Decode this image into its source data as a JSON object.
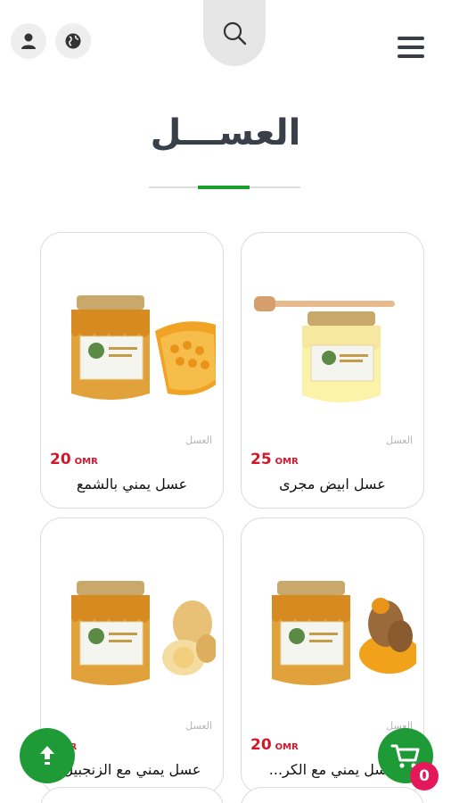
{
  "header": {
    "user_icon": "user-icon",
    "globe_icon": "globe-icon",
    "search_icon": "search-icon",
    "menu_icon": "hamburger-menu-icon"
  },
  "page_title": "العســـل",
  "colors": {
    "accent_green": "#1c9e2d",
    "price_red": "#d0182a",
    "badge_pink": "#e5195a"
  },
  "products": [
    {
      "name": "عسل ابيض مجرى",
      "category": "العسل",
      "price": "25",
      "currency": "OMR"
    },
    {
      "name": "عسل يمني بالشمع",
      "category": "العسل",
      "price": "20",
      "currency": "OMR"
    },
    {
      "name": "عسل يمني مع الكر...",
      "category": "العسل",
      "price": "20",
      "currency": "OMR"
    },
    {
      "name": "عسل يمني مع الزنجبيل",
      "category": "العسل",
      "price": "",
      "currency": "OMR"
    }
  ],
  "fab": {
    "scroll_up_icon": "arrow-up-icon",
    "cart_icon": "cart-icon",
    "cart_count": "0"
  }
}
